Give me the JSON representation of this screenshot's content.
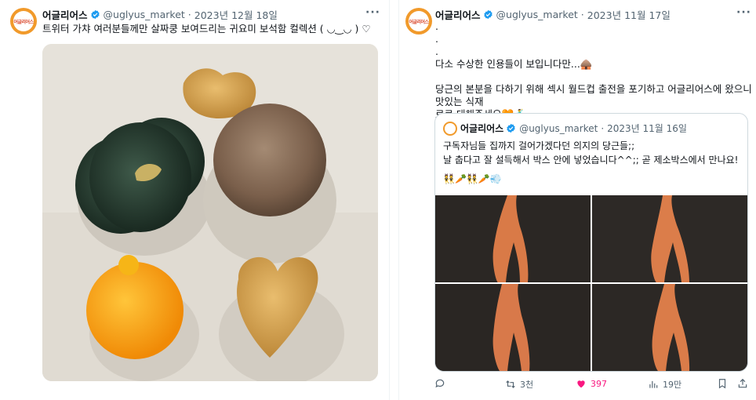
{
  "left_tweet": {
    "avatar_text": "어글리어스",
    "display_name": "어글리어스",
    "handle": "@uglyus_market",
    "separator": "·",
    "date": "2023년 12월 18일",
    "more": "···",
    "text": "트위터 가챠 여러분들께만 살짜쿵 보여드리는 귀요미 보석함 컬렉션 ( ◡‿◡ ) ♡"
  },
  "right_tweet": {
    "avatar_text": "어글리어스",
    "display_name": "어글리어스",
    "handle": "@uglyus_market",
    "separator": "·",
    "date": "2023년 11월 17일",
    "more": "···",
    "text": ".\n.\n.\n다소 수상한 인용들이 보입니다만...🛖\n\n당근의 본분을 다하기 위해 섹시 월드컵 출전을 포기하고 어글리어스에 왔으니 맛있는 식재\n료로 대해주세요🧡🕺",
    "quote": {
      "display_name": "어글리어스",
      "handle": "@uglyus_market",
      "separator": "·",
      "date": "2023년 11월 16일",
      "text": "구독자님들 집까지 걸어가겠다던 의지의 당근들;;\n날 춥다고 잘 설득해서 박스 안에 넣었습니다^^;; 곧 제소박스에서 만나요!",
      "emoji_line": "👯🥕👯🥕💨"
    },
    "actions": {
      "reply_icon": "reply-icon",
      "retweet_icon": "retweet-icon",
      "retweet_count": "3천",
      "like_icon": "heart-icon",
      "like_count": "397",
      "views_icon": "views-icon",
      "views_count": "19만",
      "bookmark_icon": "bookmark-icon",
      "share_icon": "share-icon"
    }
  },
  "colors": {
    "accent_blue": "#1d9bf0",
    "like_pink": "#f91880",
    "secondary_text": "#536471",
    "brand_orange": "#f19a2b"
  }
}
